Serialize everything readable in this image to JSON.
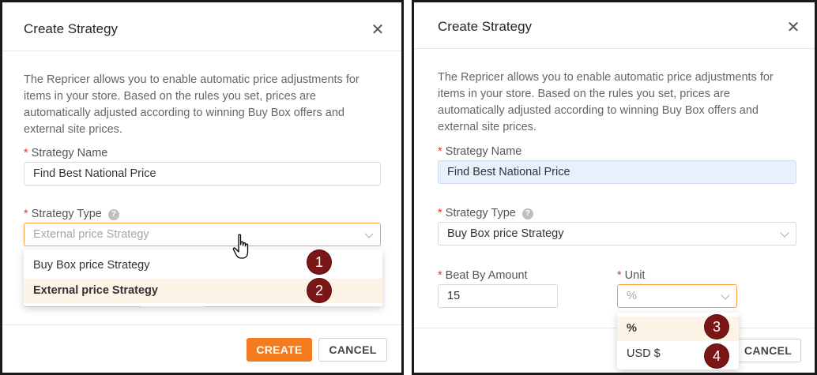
{
  "left": {
    "title": "Create Strategy",
    "close_glyph": "✕",
    "description": "The Repricer allows you to enable automatic price adjustments for items in your store. Based on the rules you set, prices are automatically adjusted according to winning Buy Box offers and external site prices.",
    "required_mark": "*",
    "strategy_name": {
      "label": "Strategy Name",
      "value": "Find Best National Price"
    },
    "strategy_type": {
      "label": "Strategy Type",
      "help_glyph": "?",
      "placeholder": "External price Strategy",
      "options": [
        "Buy Box price Strategy",
        "External price Strategy"
      ],
      "selected_index": 1
    },
    "badges": [
      "1",
      "2"
    ],
    "create_label": "CREATE",
    "cancel_label": "CANCEL",
    "cursor_icon": "hand-pointer-icon"
  },
  "right": {
    "title": "Create Strategy",
    "close_glyph": "✕",
    "description": "The Repricer allows you to enable automatic price adjustments for items in your store. Based on the rules you set, prices are automatically adjusted according to winning Buy Box offers and external site prices.",
    "required_mark": "*",
    "strategy_name": {
      "label": "Strategy Name",
      "value": "Find Best National Price"
    },
    "strategy_type": {
      "label": "Strategy Type",
      "help_glyph": "?",
      "value": "Buy Box price Strategy"
    },
    "beat_by_amount": {
      "label": "Beat By Amount",
      "value": "15"
    },
    "unit": {
      "label": "Unit",
      "placeholder": "%",
      "options": [
        "%",
        "USD $"
      ],
      "selected_index": 0
    },
    "badges": [
      "3",
      "4"
    ],
    "cancel_label": "CANCEL"
  },
  "colors": {
    "accent": "#f47b20",
    "focus_border": "#ffa040",
    "required": "#e5352b",
    "badge": "#7a1616",
    "active_option_bg": "#fdf3e7",
    "autofill_bg": "#e8f0fe"
  }
}
